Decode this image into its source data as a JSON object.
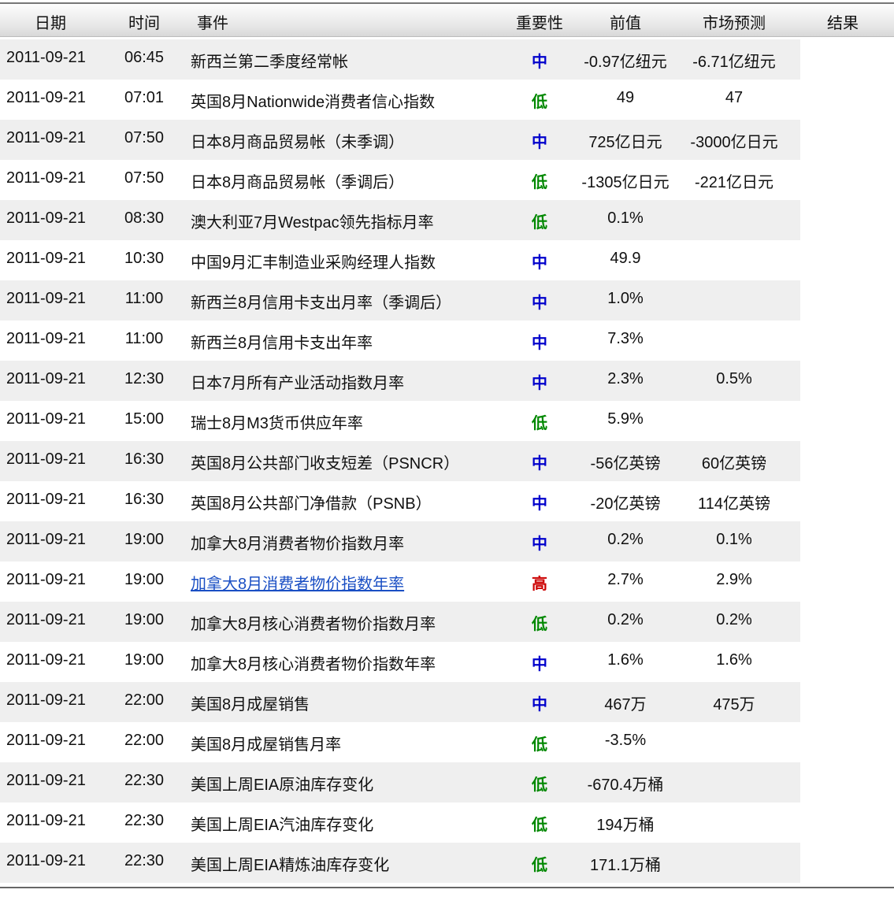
{
  "header": {
    "date": "日期",
    "time": "时间",
    "event": "事件",
    "importance": "重要性",
    "previous": "前值",
    "forecast": "市场预测",
    "result": "结果"
  },
  "colors": {
    "中": "#0000cc",
    "低": "#008800",
    "高": "#cc0000"
  },
  "rows": [
    {
      "date": "2011-09-21",
      "time": "06:45",
      "event": "新西兰第二季度经常帐",
      "importance": "中",
      "previous": "-0.97亿纽元",
      "forecast": "-6.71亿纽元",
      "result": ""
    },
    {
      "date": "2011-09-21",
      "time": "07:01",
      "event": "英国8月Nationwide消费者信心指数",
      "importance": "低",
      "previous": "49",
      "forecast": "47",
      "result": ""
    },
    {
      "date": "2011-09-21",
      "time": "07:50",
      "event": "日本8月商品贸易帐（未季调）",
      "importance": "中",
      "previous": "725亿日元",
      "forecast": "-3000亿日元",
      "result": ""
    },
    {
      "date": "2011-09-21",
      "time": "07:50",
      "event": "日本8月商品贸易帐（季调后）",
      "importance": "低",
      "previous": "-1305亿日元",
      "forecast": "-221亿日元",
      "result": ""
    },
    {
      "date": "2011-09-21",
      "time": "08:30",
      "event": "澳大利亚7月Westpac领先指标月率",
      "importance": "低",
      "previous": "0.1%",
      "forecast": "",
      "result": ""
    },
    {
      "date": "2011-09-21",
      "time": "10:30",
      "event": "中国9月汇丰制造业采购经理人指数",
      "importance": "中",
      "previous": "49.9",
      "forecast": "",
      "result": ""
    },
    {
      "date": "2011-09-21",
      "time": "11:00",
      "event": "新西兰8月信用卡支出月率（季调后）",
      "importance": "中",
      "previous": "1.0%",
      "forecast": "",
      "result": ""
    },
    {
      "date": "2011-09-21",
      "time": "11:00",
      "event": "新西兰8月信用卡支出年率",
      "importance": "中",
      "previous": "7.3%",
      "forecast": "",
      "result": ""
    },
    {
      "date": "2011-09-21",
      "time": "12:30",
      "event": "日本7月所有产业活动指数月率",
      "importance": "中",
      "previous": "2.3%",
      "forecast": "0.5%",
      "result": ""
    },
    {
      "date": "2011-09-21",
      "time": "15:00",
      "event": "瑞士8月M3货币供应年率",
      "importance": "低",
      "previous": "5.9%",
      "forecast": "",
      "result": ""
    },
    {
      "date": "2011-09-21",
      "time": "16:30",
      "event": "英国8月公共部门收支短差（PSNCR）",
      "importance": "中",
      "previous": "-56亿英镑",
      "forecast": "60亿英镑",
      "result": ""
    },
    {
      "date": "2011-09-21",
      "time": "16:30",
      "event": "英国8月公共部门净借款（PSNB）",
      "importance": "中",
      "previous": "-20亿英镑",
      "forecast": "114亿英镑",
      "result": ""
    },
    {
      "date": "2011-09-21",
      "time": "19:00",
      "event": "加拿大8月消费者物价指数月率",
      "importance": "中",
      "previous": "0.2%",
      "forecast": "0.1%",
      "result": ""
    },
    {
      "date": "2011-09-21",
      "time": "19:00",
      "event": "加拿大8月消费者物价指数年率",
      "importance": "高",
      "previous": "2.7%",
      "forecast": "2.9%",
      "result": "",
      "link": true
    },
    {
      "date": "2011-09-21",
      "time": "19:00",
      "event": "加拿大8月核心消费者物价指数月率",
      "importance": "低",
      "previous": "0.2%",
      "forecast": "0.2%",
      "result": ""
    },
    {
      "date": "2011-09-21",
      "time": "19:00",
      "event": "加拿大8月核心消费者物价指数年率",
      "importance": "中",
      "previous": "1.6%",
      "forecast": "1.6%",
      "result": ""
    },
    {
      "date": "2011-09-21",
      "time": "22:00",
      "event": "美国8月成屋销售",
      "importance": "中",
      "previous": "467万",
      "forecast": "475万",
      "result": ""
    },
    {
      "date": "2011-09-21",
      "time": "22:00",
      "event": "美国8月成屋销售月率",
      "importance": "低",
      "previous": "-3.5%",
      "forecast": "",
      "result": ""
    },
    {
      "date": "2011-09-21",
      "time": "22:30",
      "event": "美国上周EIA原油库存变化",
      "importance": "低",
      "previous": "-670.4万桶",
      "forecast": "",
      "result": ""
    },
    {
      "date": "2011-09-21",
      "time": "22:30",
      "event": "美国上周EIA汽油库存变化",
      "importance": "低",
      "previous": "194万桶",
      "forecast": "",
      "result": ""
    },
    {
      "date": "2011-09-21",
      "time": "22:30",
      "event": "美国上周EIA精炼油库存变化",
      "importance": "低",
      "previous": "171.1万桶",
      "forecast": "",
      "result": ""
    }
  ]
}
